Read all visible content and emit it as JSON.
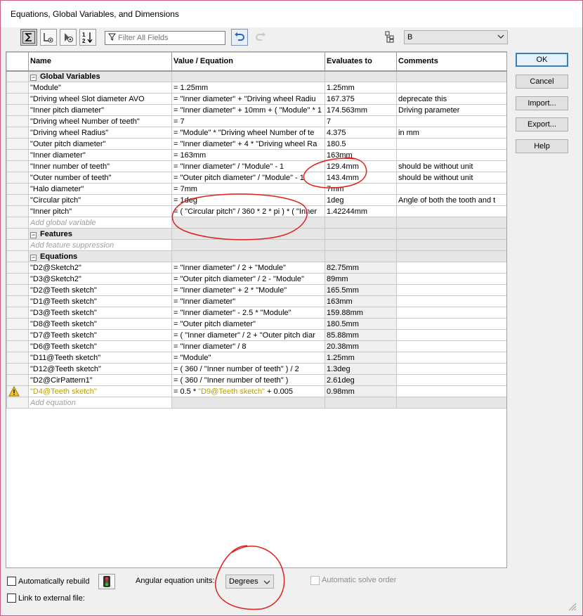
{
  "window": {
    "title": "Equations, Global Variables, and Dimensions"
  },
  "toolbar": {
    "filter_placeholder": "Filter All Fields",
    "configuration_value": "B"
  },
  "columns": {
    "name": "Name",
    "value": "Value / Equation",
    "evaluates": "Evaluates to",
    "comments": "Comments"
  },
  "sections": {
    "global_variables": {
      "label": "Global Variables",
      "add_placeholder": "Add global variable",
      "rows": [
        {
          "name": "\"Module\"",
          "value": "= 1.25mm",
          "evaluates": "1.25mm",
          "comment": ""
        },
        {
          "name": "\"Driving wheel Slot diameter AVO",
          "value": "= \"Inner diameter\" + \"Driving wheel Radiu",
          "evaluates": "167.375",
          "comment": "deprecate this"
        },
        {
          "name": "\"Inner pitch diameter\"",
          "value": "= \"Inner diameter\" + 10mm + ( \"Module\" * 1",
          "evaluates": "174.563mm",
          "comment": "Driving parameter"
        },
        {
          "name": "\"Driving wheel Number of teeth\"",
          "value": "= 7",
          "evaluates": "7",
          "comment": ""
        },
        {
          "name": "\"Driving wheel Radius\"",
          "value": "= \"Module\" * \"Driving wheel Number of te",
          "evaluates": "4.375",
          "comment": "in mm"
        },
        {
          "name": "\"Outer pitch diameter\"",
          "value": "= \"Inner diameter\" + 4 * \"Driving wheel Ra",
          "evaluates": "180.5",
          "comment": ""
        },
        {
          "name": "\"Inner diameter\"",
          "value": "= 163mm",
          "evaluates": "163mm",
          "comment": ""
        },
        {
          "name": "\"Inner number of teeth\"",
          "value": "= \"Inner diameter\" / \"Module\" - 1",
          "evaluates": "129.4mm",
          "comment": "should be without unit"
        },
        {
          "name": "\"Outer number of teeth\"",
          "value": "= \"Outer pitch diameter\" / \"Module\" - 1",
          "evaluates": "143.4mm",
          "comment": "should be without unit"
        },
        {
          "name": "\"Halo diameter\"",
          "value": "= 7mm",
          "evaluates": "7mm",
          "comment": ""
        },
        {
          "name": "\"Circular pitch\"",
          "value": "= 1deg",
          "evaluates": "1deg",
          "comment": "Angle of both the tooth and t"
        },
        {
          "name": "\"Inner pitch\"",
          "value": "= ( \"Circular pitch\" / 360 * 2 * pi ) * ( \"Inner",
          "evaluates": "1.42244mm",
          "comment": ""
        }
      ]
    },
    "features": {
      "label": "Features",
      "add_placeholder": "Add feature suppression"
    },
    "equations": {
      "label": "Equations",
      "add_placeholder": "Add equation",
      "rows": [
        {
          "name": "\"D2@Sketch2\"",
          "value": "= \"Inner diameter\" / 2 + \"Module\"",
          "evaluates": "82.75mm",
          "comment": ""
        },
        {
          "name": "\"D3@Sketch2\"",
          "value": "= \"Outer pitch diameter\" / 2 - \"Module\"",
          "evaluates": "89mm",
          "comment": ""
        },
        {
          "name": "\"D2@Teeth sketch\"",
          "value": "= \"Inner diameter\" + 2 * \"Module\"",
          "evaluates": "165.5mm",
          "comment": ""
        },
        {
          "name": "\"D1@Teeth sketch\"",
          "value": "= \"Inner diameter\"",
          "evaluates": "163mm",
          "comment": ""
        },
        {
          "name": "\"D3@Teeth sketch\"",
          "value": "= \"Inner diameter\" - 2.5 * \"Module\"",
          "evaluates": "159.88mm",
          "comment": ""
        },
        {
          "name": "\"D8@Teeth sketch\"",
          "value": "= \"Outer pitch diameter\"",
          "evaluates": "180.5mm",
          "comment": ""
        },
        {
          "name": "\"D7@Teeth sketch\"",
          "value": "= ( \"Inner diameter\" / 2 + \"Outer pitch diar",
          "evaluates": "85.88mm",
          "comment": ""
        },
        {
          "name": "\"D6@Teeth sketch\"",
          "value": "= \"Inner diameter\" / 8",
          "evaluates": "20.38mm",
          "comment": ""
        },
        {
          "name": "\"D11@Teeth sketch\"",
          "value": "= \"Module\"",
          "evaluates": "1.25mm",
          "comment": ""
        },
        {
          "name": "\"D12@Teeth sketch\"",
          "value": "= ( 360 / \"Inner number of teeth\" ) / 2",
          "evaluates": "1.3deg",
          "comment": ""
        },
        {
          "name": "\"D2@CirPattern1\"",
          "value": "= ( 360 / \"Inner number of teeth\" )",
          "evaluates": "2.61deg",
          "comment": ""
        }
      ],
      "warning_row": {
        "name": "\"D4@Teeth sketch\"",
        "value_prefix": "= 0.5 * ",
        "value_ref": "\"D9@Teeth sketch\"",
        "value_suffix": " + 0.005",
        "evaluates": "0.98mm"
      }
    }
  },
  "buttons": {
    "ok": "OK",
    "cancel": "Cancel",
    "import": "Import...",
    "export": "Export...",
    "help": "Help"
  },
  "bottom": {
    "auto_rebuild": "Automatically rebuild",
    "angular_units_label": "Angular equation units:",
    "angular_units_value": "Degrees",
    "auto_solve": "Automatic solve order",
    "link_external": "Link to external file:"
  },
  "colors": {
    "warning_text": "#b9a000",
    "annotation": "#e0201c",
    "ok_border": "#3c7fb1"
  }
}
